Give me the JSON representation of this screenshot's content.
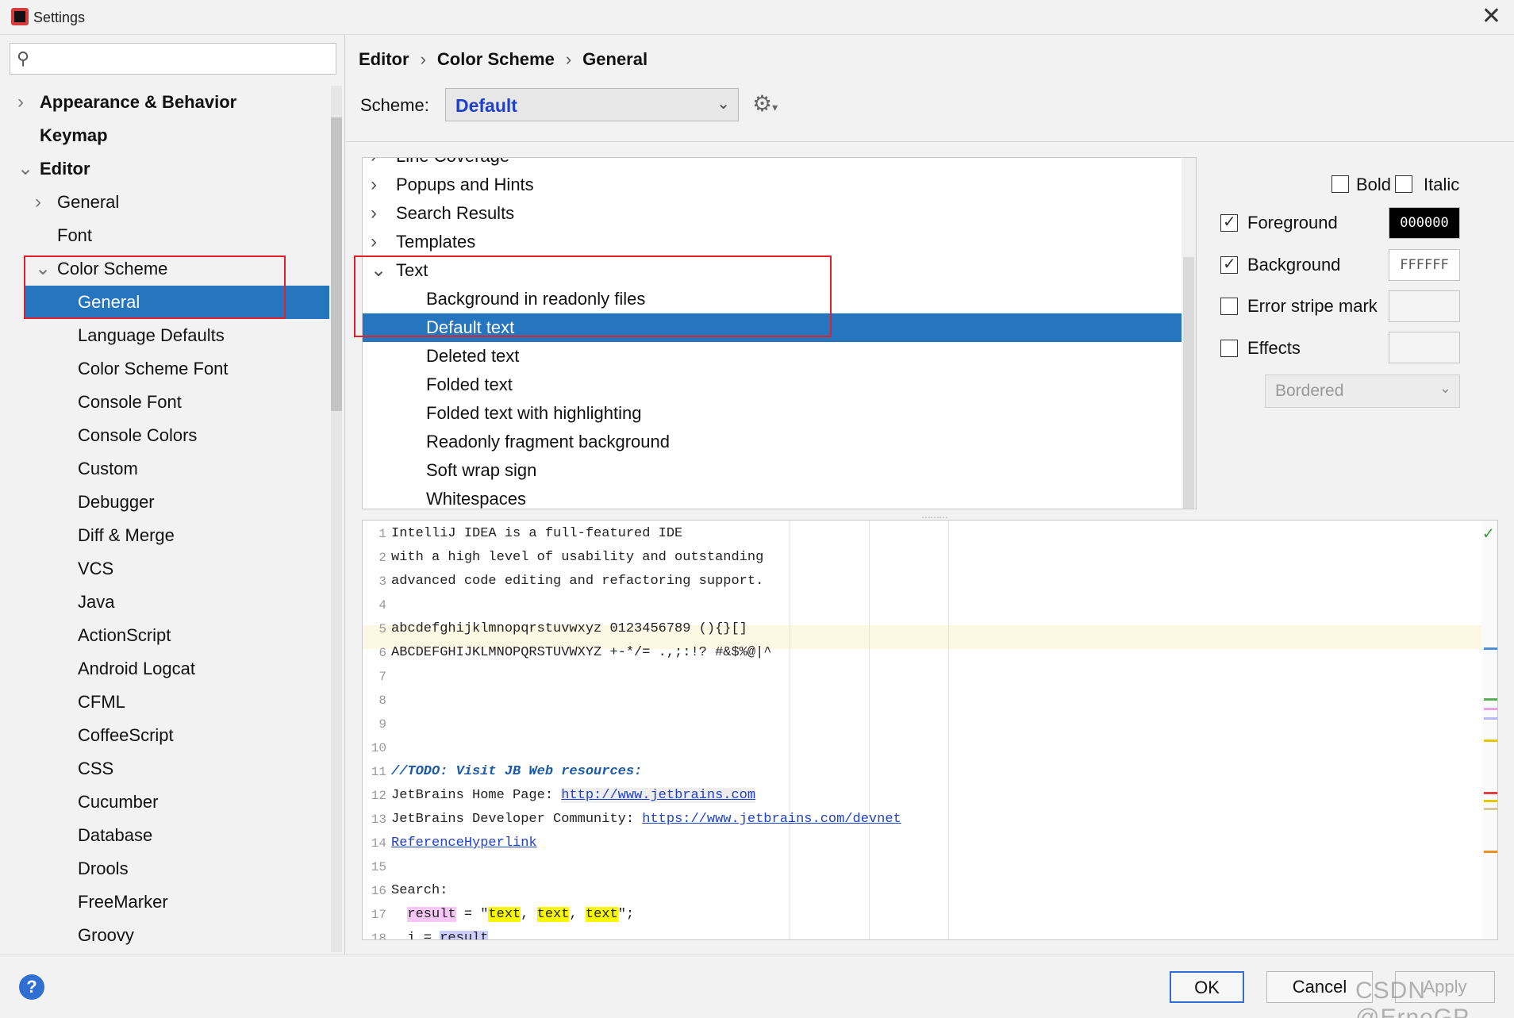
{
  "window": {
    "title": "Settings"
  },
  "sidebar": {
    "items": [
      {
        "label": "Appearance & Behavior",
        "bold": true,
        "chevron": "right",
        "indent": 0
      },
      {
        "label": "Keymap",
        "bold": true,
        "chevron": "",
        "indent": 0
      },
      {
        "label": "Editor",
        "bold": true,
        "chevron": "down",
        "indent": 0
      },
      {
        "label": "General",
        "bold": false,
        "chevron": "right",
        "indent": 1
      },
      {
        "label": "Font",
        "bold": false,
        "chevron": "",
        "indent": 1
      },
      {
        "label": "Color Scheme",
        "bold": false,
        "chevron": "down",
        "indent": 1
      },
      {
        "label": "General",
        "bold": false,
        "chevron": "",
        "indent": 2,
        "selected": true
      },
      {
        "label": "Language Defaults",
        "bold": false,
        "chevron": "",
        "indent": 2
      },
      {
        "label": "Color Scheme Font",
        "bold": false,
        "chevron": "",
        "indent": 2
      },
      {
        "label": "Console Font",
        "bold": false,
        "chevron": "",
        "indent": 2
      },
      {
        "label": "Console Colors",
        "bold": false,
        "chevron": "",
        "indent": 2
      },
      {
        "label": "Custom",
        "bold": false,
        "chevron": "",
        "indent": 2
      },
      {
        "label": "Debugger",
        "bold": false,
        "chevron": "",
        "indent": 2
      },
      {
        "label": "Diff & Merge",
        "bold": false,
        "chevron": "",
        "indent": 2
      },
      {
        "label": "VCS",
        "bold": false,
        "chevron": "",
        "indent": 2
      },
      {
        "label": "Java",
        "bold": false,
        "chevron": "",
        "indent": 2
      },
      {
        "label": "ActionScript",
        "bold": false,
        "chevron": "",
        "indent": 2
      },
      {
        "label": "Android Logcat",
        "bold": false,
        "chevron": "",
        "indent": 2
      },
      {
        "label": "CFML",
        "bold": false,
        "chevron": "",
        "indent": 2
      },
      {
        "label": "CoffeeScript",
        "bold": false,
        "chevron": "",
        "indent": 2
      },
      {
        "label": "CSS",
        "bold": false,
        "chevron": "",
        "indent": 2
      },
      {
        "label": "Cucumber",
        "bold": false,
        "chevron": "",
        "indent": 2
      },
      {
        "label": "Database",
        "bold": false,
        "chevron": "",
        "indent": 2
      },
      {
        "label": "Drools",
        "bold": false,
        "chevron": "",
        "indent": 2
      },
      {
        "label": "FreeMarker",
        "bold": false,
        "chevron": "",
        "indent": 2
      },
      {
        "label": "Groovy",
        "bold": false,
        "chevron": "",
        "indent": 2
      }
    ]
  },
  "breadcrumb": {
    "part1": "Editor",
    "part2": "Color Scheme",
    "part3": "General",
    "sep": "›"
  },
  "scheme": {
    "label": "Scheme:",
    "value": "Default"
  },
  "attributes": {
    "items": [
      {
        "label": "Line Coverage",
        "chevron": "right",
        "indent": 0
      },
      {
        "label": "Popups and Hints",
        "chevron": "right",
        "indent": 0
      },
      {
        "label": "Search Results",
        "chevron": "right",
        "indent": 0
      },
      {
        "label": "Templates",
        "chevron": "right",
        "indent": 0
      },
      {
        "label": "Text",
        "chevron": "down",
        "indent": 0
      },
      {
        "label": "Background in readonly files",
        "chevron": "",
        "indent": 1
      },
      {
        "label": "Default text",
        "chevron": "",
        "indent": 1,
        "selected": true
      },
      {
        "label": "Deleted text",
        "chevron": "",
        "indent": 1
      },
      {
        "label": "Folded text",
        "chevron": "",
        "indent": 1
      },
      {
        "label": "Folded text with highlighting",
        "chevron": "",
        "indent": 1
      },
      {
        "label": "Readonly fragment background",
        "chevron": "",
        "indent": 1
      },
      {
        "label": "Soft wrap sign",
        "chevron": "",
        "indent": 1
      },
      {
        "label": "Whitespaces",
        "chevron": "",
        "indent": 1
      }
    ]
  },
  "options": {
    "bold_label": "Bold",
    "bold_checked": false,
    "italic_label": "Italic",
    "italic_checked": false,
    "foreground_label": "Foreground",
    "foreground_checked": true,
    "foreground_value": "000000",
    "background_label": "Background",
    "background_checked": true,
    "background_value": "FFFFFF",
    "error_stripe_label": "Error stripe mark",
    "error_stripe_checked": false,
    "effects_label": "Effects",
    "effects_checked": false,
    "effects_type": "Bordered"
  },
  "preview": {
    "line_numbers": [
      "1",
      "2",
      "3",
      "4",
      "5",
      "6",
      "7",
      "8",
      "9",
      "10",
      "11",
      "12",
      "13",
      "14",
      "15",
      "16",
      "17",
      "18"
    ],
    "line1": "IntelliJ IDEA is a full-featured IDE",
    "line2": "with a high level of usability and outstanding",
    "line3": "advanced code editing and refactoring support.",
    "line5": "abcdefghijklmnopqrstuvwxyz 0123456789 (){}[]",
    "line6": "ABCDEFGHIJKLMNOPQRSTUVWXYZ +-*/= .,;:!? #&$%@|^",
    "line11": "//TODO: Visit JB Web resources:",
    "line12_text": "JetBrains Home Page: ",
    "line12_link": "http://www.jetbrains.com",
    "line13_text": "JetBrains Developer Community: ",
    "line13_link": "https://www.jetbrains.com/devnet",
    "line14_link": "ReferenceHyperlink",
    "line16": "Search:",
    "line17_var": "result",
    "line17_eq": " = \"",
    "line17_t1": "text",
    "line17_c1": ", ",
    "line17_t2": "text",
    "line17_c2": ", ",
    "line17_t3": "text",
    "line17_end": "\";",
    "line18_a": "  i = ",
    "line18_b": "result"
  },
  "buttons": {
    "ok": "OK",
    "cancel": "Cancel",
    "apply": "Apply",
    "help": "?"
  },
  "watermark": "CSDN @ErnoGP",
  "colors": {
    "accent": "#2675bf",
    "annotation_red": "#e0202a",
    "scheme_value": "#1f3fcf"
  }
}
